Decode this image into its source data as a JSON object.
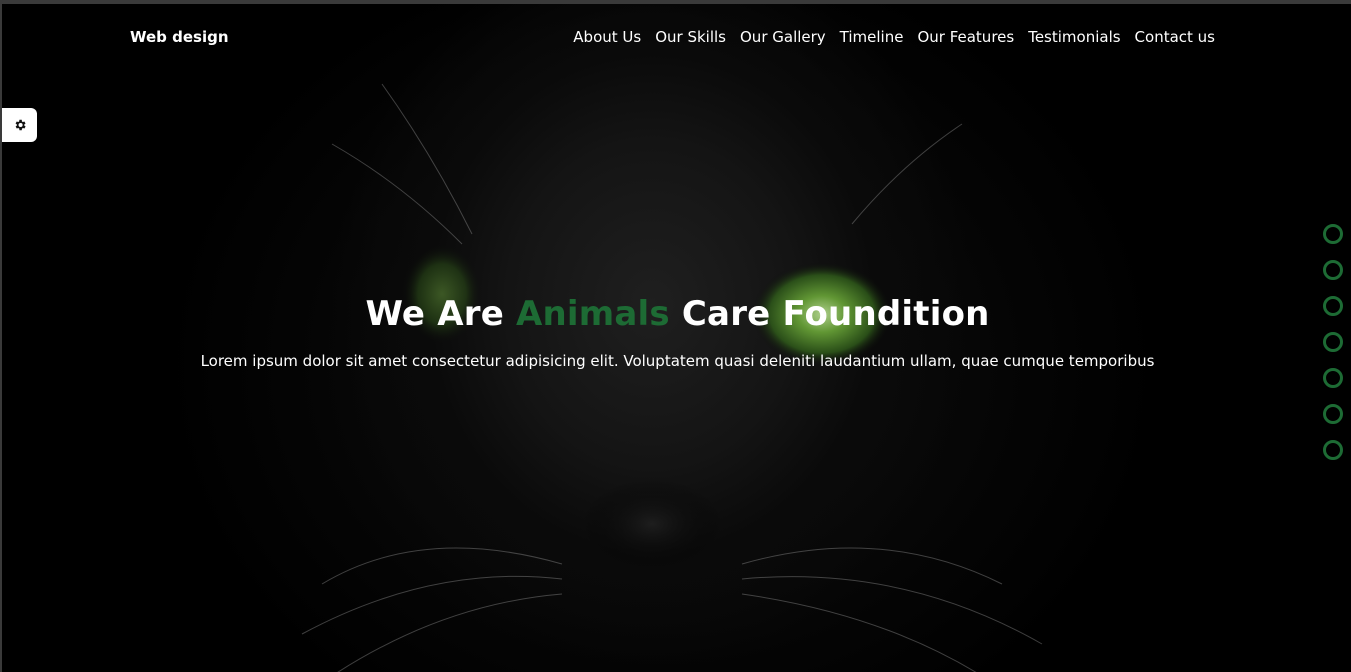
{
  "navbar": {
    "brand": "Web design",
    "links": [
      {
        "label": "About Us"
      },
      {
        "label": "Our Skills"
      },
      {
        "label": "Our Gallery"
      },
      {
        "label": "Timeline"
      },
      {
        "label": "Our Features"
      },
      {
        "label": "Testimonials"
      },
      {
        "label": "Contact us"
      }
    ]
  },
  "settings": {
    "icon": "gear-icon"
  },
  "hero": {
    "title_before": "We Are ",
    "title_accent": "Animals",
    "title_after": " Care Foundition",
    "subtitle": "Lorem ipsum dolor sit amet consectetur adipisicing elit. Voluptatem quasi deleniti laudantium ullam, quae cumque temporibus"
  },
  "bullets": {
    "count": 7
  },
  "colors": {
    "accent": "#1d6b34",
    "background": "#000000",
    "text": "#ffffff"
  }
}
